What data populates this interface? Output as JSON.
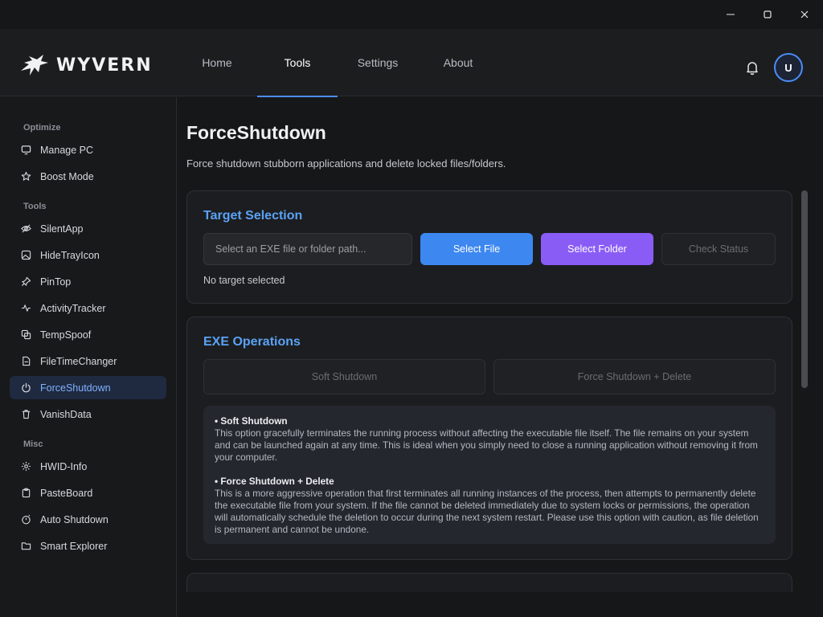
{
  "window": {
    "controls": [
      "minimize-icon",
      "maximize-icon",
      "close-icon"
    ]
  },
  "header": {
    "brand": "WYVERN",
    "tabs": [
      {
        "label": "Home",
        "active": false
      },
      {
        "label": "Tools",
        "active": true
      },
      {
        "label": "Settings",
        "active": false
      },
      {
        "label": "About",
        "active": false
      }
    ],
    "avatar_initial": "U",
    "accent": "#4a8df6"
  },
  "sidebar": {
    "sections": [
      {
        "label": "Optimize",
        "items": [
          {
            "label": "Manage PC",
            "icon": "monitor-icon"
          },
          {
            "label": "Boost Mode",
            "icon": "star-icon"
          }
        ]
      },
      {
        "label": "Tools",
        "items": [
          {
            "label": "SilentApp",
            "icon": "eye-off-icon"
          },
          {
            "label": "HideTrayIcon",
            "icon": "image-icon"
          },
          {
            "label": "PinTop",
            "icon": "pin-icon"
          },
          {
            "label": "ActivityTracker",
            "icon": "activity-icon"
          },
          {
            "label": "TempSpoof",
            "icon": "copy-icon"
          },
          {
            "label": "FileTimeChanger",
            "icon": "file-icon"
          },
          {
            "label": "ForceShutdown",
            "icon": "power-icon",
            "active": true
          },
          {
            "label": "VanishData",
            "icon": "trash-icon"
          }
        ]
      },
      {
        "label": "Misc",
        "items": [
          {
            "label": "HWID-Info",
            "icon": "gear-icon"
          },
          {
            "label": "PasteBoard",
            "icon": "clipboard-icon"
          },
          {
            "label": "Auto Shutdown",
            "icon": "timer-icon"
          },
          {
            "label": "Smart Explorer",
            "icon": "folder-icon"
          }
        ]
      }
    ]
  },
  "main": {
    "title": "ForceShutdown",
    "description": "Force shutdown stubborn applications and delete locked files/folders.",
    "target": {
      "title": "Target Selection",
      "input_placeholder": "Select an EXE file or folder path...",
      "input_value": "",
      "select_file": "Select File",
      "select_folder": "Select Folder",
      "check_status": "Check Status",
      "status": "No target selected"
    },
    "exe": {
      "title": "EXE Operations",
      "soft_shutdown": "Soft Shutdown",
      "force_delete": "Force Shutdown + Delete",
      "info": {
        "soft_head": "• Soft Shutdown",
        "soft_text": "This option gracefully terminates the running process without affecting the executable file itself. The file remains on your system and can be launched again at any time. This is ideal when you simply need to close a running application without removing it from your computer.",
        "force_head": "• Force Shutdown + Delete",
        "force_text": "This is a more aggressive operation that first terminates all running instances of the process, then attempts to permanently delete the executable file from your system. If the file cannot be deleted immediately due to system locks or permissions, the operation will automatically schedule the deletion to occur during the next system restart. Please use this option with caution, as file deletion is permanent and cannot be undone."
      }
    }
  }
}
